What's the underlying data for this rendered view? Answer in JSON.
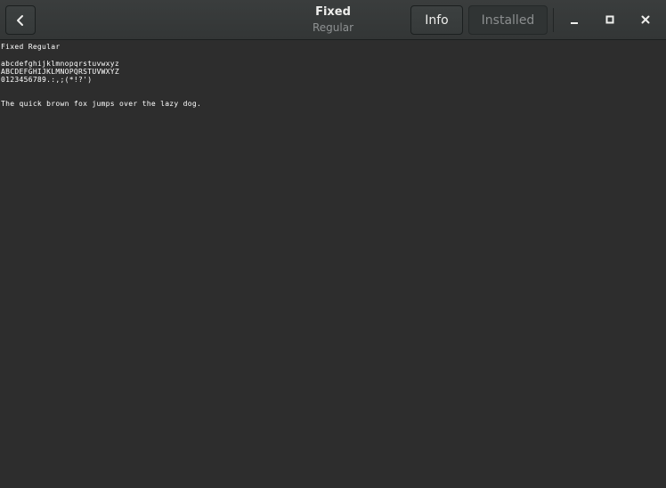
{
  "header": {
    "title": "Fixed",
    "subtitle": "Regular",
    "info_label": "Info",
    "installed_label": "Installed",
    "back_icon": "chevron-left-icon",
    "minimize_icon": "minimize-icon",
    "maximize_icon": "maximize-icon",
    "close_icon": "close-icon"
  },
  "preview": {
    "font_name": "Fixed Regular",
    "lowercase": "abcdefghijklmnopqrstuvwxyz",
    "uppercase": "ABCDEFGHIJKLMNOPQRSTUVWXYZ",
    "digits": "0123456789.:,;(*!?')",
    "sample": "The quick brown fox jumps over the lazy dog."
  },
  "colors": {
    "background": "#2d2d2d",
    "text": "#ffffff",
    "headerbar": "#353838"
  }
}
